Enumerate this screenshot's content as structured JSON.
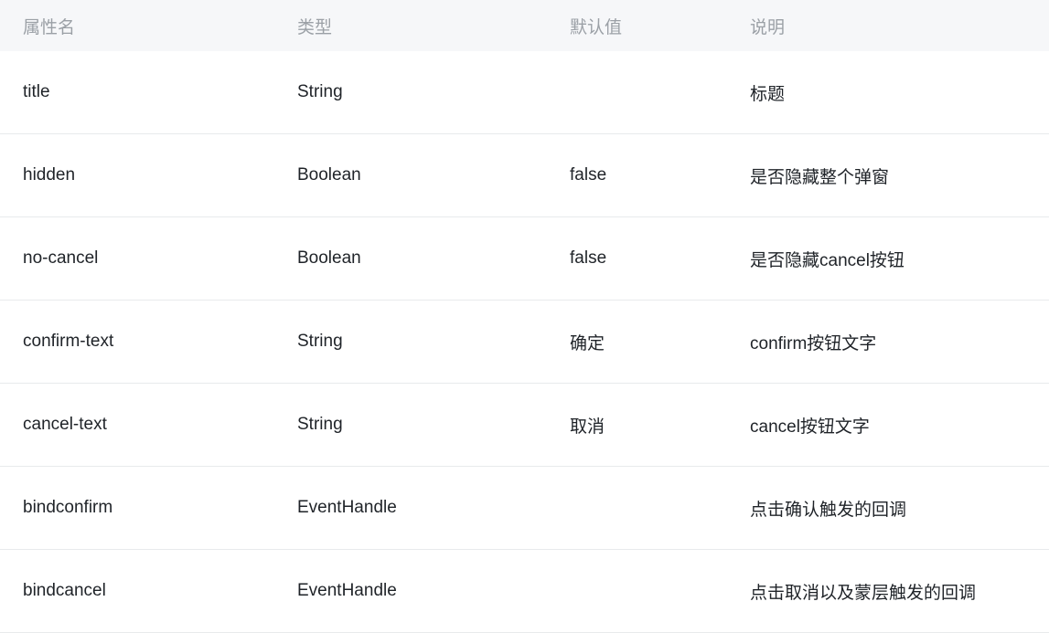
{
  "table": {
    "columns": [
      {
        "key": "name",
        "label": "属性名"
      },
      {
        "key": "type",
        "label": "类型"
      },
      {
        "key": "default",
        "label": "默认值"
      },
      {
        "key": "desc",
        "label": "说明"
      }
    ],
    "rows": [
      {
        "name": "title",
        "type": "String",
        "default": "",
        "desc": "标题"
      },
      {
        "name": "hidden",
        "type": "Boolean",
        "default": "false",
        "desc": "是否隐藏整个弹窗"
      },
      {
        "name": "no-cancel",
        "type": "Boolean",
        "default": "false",
        "desc": "是否隐藏cancel按钮"
      },
      {
        "name": "confirm-text",
        "type": "String",
        "default": "确定",
        "desc": "confirm按钮文字"
      },
      {
        "name": "cancel-text",
        "type": "String",
        "default": "取消",
        "desc": "cancel按钮文字"
      },
      {
        "name": "bindconfirm",
        "type": "EventHandle",
        "default": "",
        "desc": "点击确认触发的回调"
      },
      {
        "name": "bindcancel",
        "type": "EventHandle",
        "default": "",
        "desc": "点击取消以及蒙层触发的回调"
      }
    ]
  },
  "theme": {
    "header_background": "#f6f7f9",
    "header_text": "#9ba0a6",
    "body_text": "#1f2328",
    "row_border": "#e8eaec",
    "page_background": "#ffffff"
  }
}
